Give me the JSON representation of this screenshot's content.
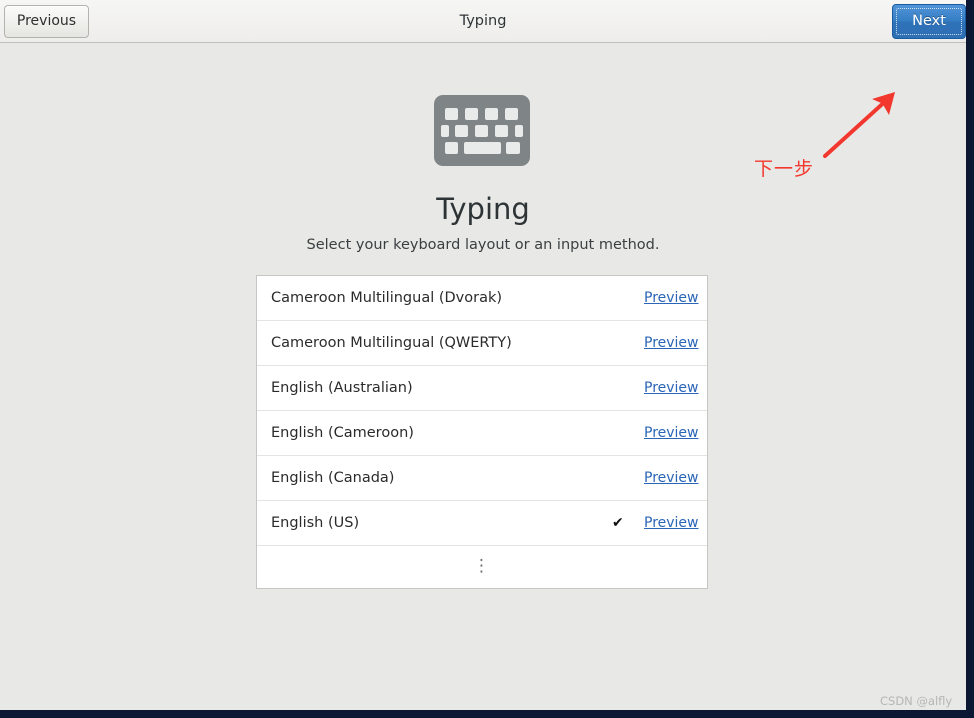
{
  "header": {
    "title": "Typing",
    "previous_label": "Previous",
    "next_label": "Next"
  },
  "main": {
    "icon": "keyboard-icon",
    "title": "Typing",
    "subtitle": "Select your keyboard layout or an input method.",
    "preview_label": "Preview",
    "check_glyph": "✔",
    "more_glyph": "⋮",
    "rows": [
      {
        "label": "Cameroon Multilingual (Dvorak)",
        "selected": false
      },
      {
        "label": "Cameroon Multilingual (QWERTY)",
        "selected": false
      },
      {
        "label": "English (Australian)",
        "selected": false
      },
      {
        "label": "English (Cameroon)",
        "selected": false
      },
      {
        "label": "English (Canada)",
        "selected": false
      },
      {
        "label": "English (US)",
        "selected": true
      }
    ]
  },
  "annotation": {
    "text": "下一步",
    "color": "#f2382e"
  },
  "watermark": {
    "text": "CSDN @alfly"
  },
  "colors": {
    "accent_blue": "#2f72b8",
    "link_blue": "#2a65b7",
    "window_bg": "#e8e8e6",
    "header_bg": "#f2f1f0",
    "icon_gray": "#7f8487",
    "annotation_red": "#f2382e",
    "frame_navy": "#0b1733"
  }
}
